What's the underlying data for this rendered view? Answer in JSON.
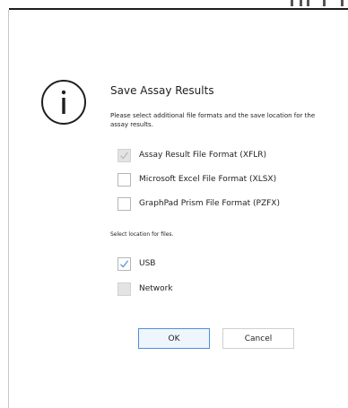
{
  "dialog": {
    "title": "Save Assay Results",
    "description": "Please select additional file formats and the save location for the assay results.",
    "format_options": [
      {
        "label": "Assay Result File Format (XFLR)",
        "checked": true,
        "disabled": true
      },
      {
        "label": "Microsoft Excel File Format (XLSX)",
        "checked": false,
        "disabled": false
      },
      {
        "label": "GraphPad Prism File Format (PZFX)",
        "checked": false,
        "disabled": false
      }
    ],
    "location_label": "Select location for files.",
    "location_options": [
      {
        "label": "USB",
        "checked": true,
        "disabled": false
      },
      {
        "label": "Network",
        "checked": false,
        "disabled": true
      }
    ],
    "ok_label": "OK",
    "cancel_label": "Cancel"
  },
  "icons": {
    "info": "info-icon",
    "check": "checkmark-icon"
  },
  "colors": {
    "check_enabled": "#4f90d8",
    "check_disabled": "#b8b8b8",
    "ok_border": "#4f90d8",
    "ok_background": "#eef5fc"
  }
}
